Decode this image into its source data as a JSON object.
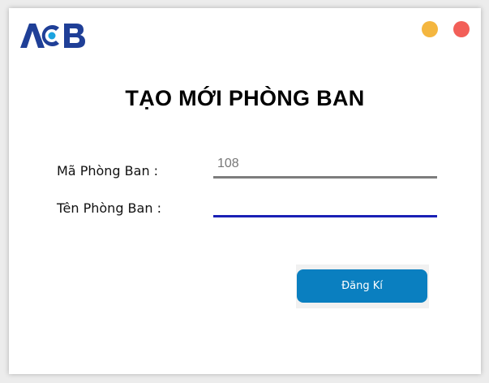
{
  "brand": {
    "logo_text": "ACB",
    "color": "#1f3f97",
    "accent": "#1aa3e0"
  },
  "window_controls": {
    "minimize_color": "#f4b63f",
    "close_color": "#f25f58"
  },
  "form": {
    "title": "TẠO MỚI PHÒNG BAN",
    "code_label": "Mã Phòng Ban :",
    "code_value": "108",
    "name_label": "Tên Phòng Ban :",
    "name_value": "",
    "submit_label": "Đăng Kí"
  }
}
